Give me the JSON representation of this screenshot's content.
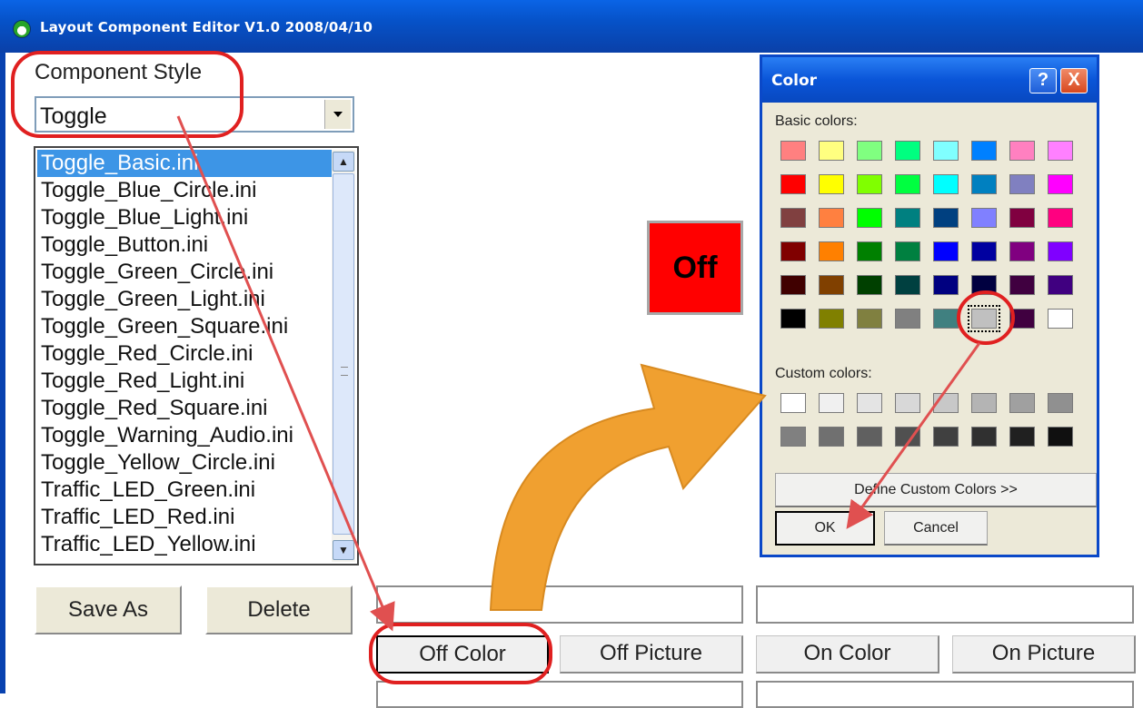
{
  "window": {
    "title": "Layout Component Editor V1.0  2008/04/10",
    "icon": "app-icon"
  },
  "component_style": {
    "label": "Component Style",
    "selected": "Toggle"
  },
  "ini_list": {
    "items": [
      "Toggle_Basic.ini",
      "Toggle_Blue_Circle.ini",
      "Toggle_Blue_Light.ini",
      "Toggle_Button.ini",
      "Toggle_Green_Circle.ini",
      "Toggle_Green_Light.ini",
      "Toggle_Green_Square.ini",
      "Toggle_Red_Circle.ini",
      "Toggle_Red_Light.ini",
      "Toggle_Red_Square.ini",
      "Toggle_Warning_Audio.ini",
      "Toggle_Yellow_Circle.ini",
      "Traffic_LED_Green.ini",
      "Traffic_LED_Red.ini",
      "Traffic_LED_Yellow.ini"
    ],
    "selected_index": 0
  },
  "buttons": {
    "save_as": "Save As",
    "delete": "Delete",
    "off_color": "Off Color",
    "off_picture": "Off Picture",
    "on_color": "On Color",
    "on_picture": "On Picture"
  },
  "preview": {
    "label": "Off",
    "color": "#ff0000"
  },
  "color_dialog": {
    "title": "Color",
    "help": "?",
    "close": "X",
    "basic_label": "Basic colors:",
    "custom_label": "Custom colors:",
    "define_custom": "Define Custom Colors >>",
    "ok": "OK",
    "cancel": "Cancel",
    "basic_colors": [
      [
        "#ff8080",
        "#ffff80",
        "#80ff80",
        "#00ff80",
        "#80ffff",
        "#0080ff",
        "#ff80c0",
        "#ff80ff"
      ],
      [
        "#ff0000",
        "#ffff00",
        "#80ff00",
        "#00ff40",
        "#00ffff",
        "#0080c0",
        "#8080c0",
        "#ff00ff"
      ],
      [
        "#804040",
        "#ff8040",
        "#00ff00",
        "#008080",
        "#004080",
        "#8080ff",
        "#800040",
        "#ff0080"
      ],
      [
        "#800000",
        "#ff8000",
        "#008000",
        "#008040",
        "#0000ff",
        "#0000a0",
        "#800080",
        "#8000ff"
      ],
      [
        "#400000",
        "#804000",
        "#004000",
        "#004040",
        "#000080",
        "#000040",
        "#400040",
        "#400080"
      ],
      [
        "#000000",
        "#808000",
        "#808040",
        "#808080",
        "#408080",
        "#c0c0c0",
        "#400040",
        "#ffffff"
      ]
    ],
    "selected_basic": [
      5,
      5
    ],
    "custom_colors": [
      [
        "#ffffff",
        "#f0f0f0",
        "#e4e4e4",
        "#d8d8d8",
        "#c8c8c8",
        "#b4b4b4",
        "#a0a0a0",
        "#909090"
      ],
      [
        "#808080",
        "#707070",
        "#606060",
        "#505050",
        "#404040",
        "#303030",
        "#202020",
        "#101010"
      ]
    ]
  },
  "annotation_colors": {
    "highlight": "#e02020",
    "arrow_orange": "#f0a030"
  }
}
